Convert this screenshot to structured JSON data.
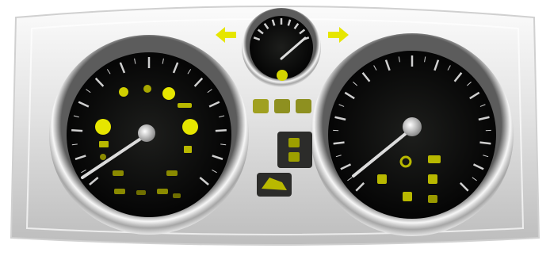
{
  "scene": {
    "subject": "instrument-cluster",
    "colors": {
      "background": "#ffffff",
      "bezel_light": "#f2f2f2",
      "bezel_mid": "#c9c9c9",
      "bezel_dark": "#8a8a8a",
      "dial_face": "#0c0d0c",
      "tick": "#cfcfcf",
      "needle": "#d6d6d6",
      "warning_yellow": "#e6e600",
      "warning_amber": "#d4cc00",
      "indicator_green": "#c8e000",
      "module_dark": "#2a2a2a"
    }
  },
  "left_gauge": {
    "name": "tachometer",
    "tick_count": 12
  },
  "right_gauge": {
    "name": "speedometer",
    "tick_count": 14
  },
  "center_gauge": {
    "name": "fuel-gauge"
  },
  "indicators": {
    "turn_left": "left-turn-arrow-icon",
    "turn_right": "right-turn-arrow-icon"
  }
}
